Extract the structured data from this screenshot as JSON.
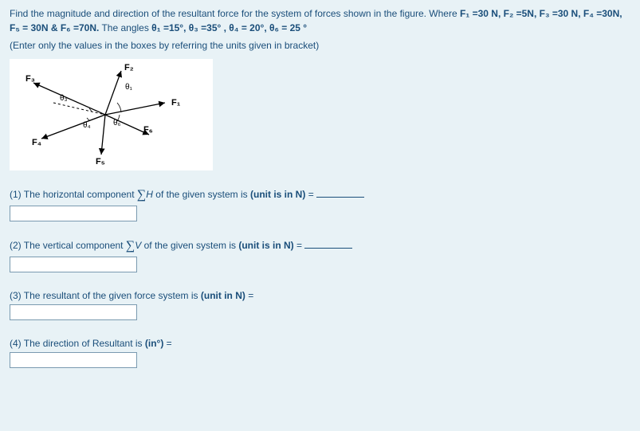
{
  "problem": {
    "intro_part1": "Find the magnitude and direction of the resultant force for the system of forces shown in the figure. Where ",
    "forces_text": "F₁ =30 N, F₂ =5N, F₃ =30 N, F₄ =30N, F₅ = 30N & F₆ =70N.",
    "intro_part2": "   The angles  ",
    "angles_text": "θ₁ =15°, θ₃ =35° , θ₄ = 20°, θ₆ = 25 °",
    "instruction": "(Enter only the values in the boxes by referring the units given in bracket)"
  },
  "figure": {
    "labels": {
      "F1": "F₁",
      "F2": "F₂",
      "F3": "F₃",
      "F4": "F₄",
      "F5": "F₅",
      "F6": "F₆",
      "t1": "θ₁",
      "t3": "θ₃",
      "t4": "θ₄",
      "t6": "θ₆"
    }
  },
  "questions": {
    "q1_pre": "(1) The horizontal component ",
    "q1_mid": "H",
    "q1_post": " of the given system is  ",
    "q1_bold": "(unit is in N)",
    "q1_eq": " = ",
    "q2_pre": "(2) The vertical component ",
    "q2_mid": "V",
    "q2_post": " of the given system is ",
    "q2_bold": "(unit is in N)",
    "q2_eq": " = ",
    "q3_pre": "(3) The resultant of the given force system is ",
    "q3_bold": "(unit in N)",
    "q3_eq": " =",
    "q4_pre": "(4) The direction of Resultant is ",
    "q4_bold": "(in°)",
    "q4_eq": " ="
  },
  "chart_data": {
    "type": "table",
    "title": "Force system vectors",
    "forces": [
      {
        "name": "F1",
        "magnitude_N": 30,
        "direction": "right, slightly above horizontal (θ1 above +x)"
      },
      {
        "name": "F2",
        "magnitude_N": 5,
        "direction": "upward vertical"
      },
      {
        "name": "F3",
        "magnitude_N": 30,
        "direction": "left, above horizontal (θ3 above -x)"
      },
      {
        "name": "F4",
        "magnitude_N": 30,
        "direction": "lower-left (θ4 below -x)"
      },
      {
        "name": "F5",
        "magnitude_N": 30,
        "direction": "downward vertical"
      },
      {
        "name": "F6",
        "magnitude_N": 70,
        "direction": "lower-right (θ6 below +x)"
      }
    ],
    "angles_deg": {
      "θ1": 15,
      "θ3": 35,
      "θ4": 20,
      "θ6": 25
    }
  }
}
